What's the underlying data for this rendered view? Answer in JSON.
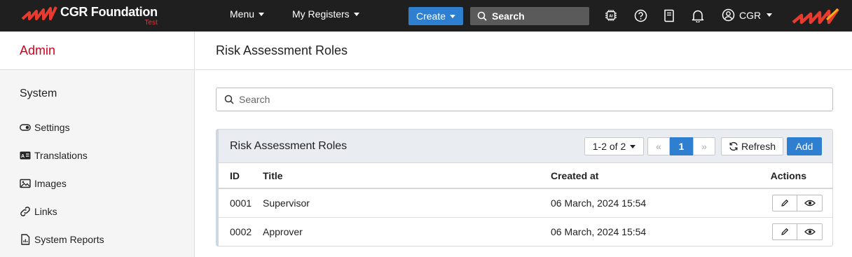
{
  "header": {
    "brand_name": "CGR Foundation",
    "brand_env": "Test",
    "menu_label": "Menu",
    "registers_label": "My Registers",
    "create_label": "Create",
    "search_placeholder": "Search",
    "user_label": "CGR",
    "icons": [
      "ai-chip-icon",
      "help-icon",
      "book-icon",
      "bell-icon",
      "user-icon"
    ]
  },
  "sidebar": {
    "title": "Admin",
    "section": "System",
    "items": [
      {
        "label": "Settings",
        "icon": "toggle-icon"
      },
      {
        "label": "Translations",
        "icon": "translations-icon"
      },
      {
        "label": "Images",
        "icon": "image-icon"
      },
      {
        "label": "Links",
        "icon": "link-icon"
      },
      {
        "label": "System Reports",
        "icon": "report-icon"
      }
    ]
  },
  "main": {
    "title": "Risk Assessment Roles",
    "search_placeholder": "Search",
    "panel": {
      "title": "Risk Assessment Roles",
      "pagination_count": "1-2 of 2",
      "prev_label": "«",
      "current_page": "1",
      "next_label": "»",
      "refresh_label": "Refresh",
      "add_label": "Add",
      "columns": [
        "ID",
        "Title",
        "Created at",
        "Actions"
      ],
      "rows": [
        {
          "id": "0001",
          "title": "Supervisor",
          "created": "06 March, 2024 15:54"
        },
        {
          "id": "0002",
          "title": "Approver",
          "created": "06 March, 2024 15:54"
        }
      ]
    }
  },
  "colors": {
    "navbar": "#1f1f1f",
    "accent": "#2f7fd1",
    "brand_red": "#d0021b"
  }
}
